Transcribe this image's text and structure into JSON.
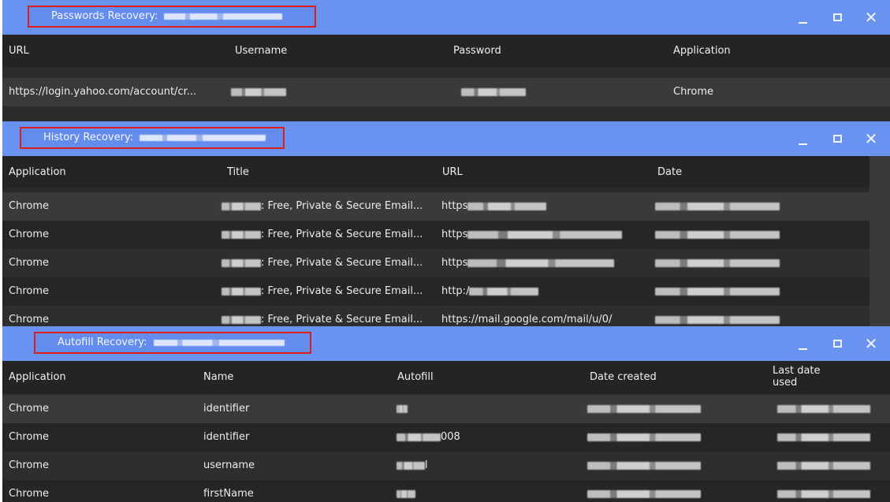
{
  "passwords": {
    "title": "Passwords Recovery:",
    "columns": [
      "URL",
      "Username",
      "Password",
      "Application"
    ],
    "rows": [
      {
        "url": "https://login.yahoo.com/account/cr...",
        "username": "",
        "password": "",
        "application": "Chrome"
      }
    ]
  },
  "history": {
    "title": "History Recovery:",
    "columns": [
      "Application",
      "Title",
      "URL",
      "Date"
    ],
    "rows": [
      {
        "application": "Chrome",
        "title": ": Free, Private & Secure Email...",
        "url": "https"
      },
      {
        "application": "Chrome",
        "title": ": Free, Private & Secure Email...",
        "url": "https"
      },
      {
        "application": "Chrome",
        "title": ": Free, Private & Secure Email...",
        "url": "https"
      },
      {
        "application": "Chrome",
        "title": ": Free, Private & Secure Email...",
        "url": "http:/"
      },
      {
        "application": "Chrome",
        "title": ": Free, Private & Secure Email...",
        "url": "https://mail.google.com/mail/u/0/"
      }
    ]
  },
  "autofill": {
    "title": "Autofill Recovery:",
    "columns": [
      "Application",
      "Name",
      "Autofill",
      "Date created",
      "Last date used"
    ],
    "rows": [
      {
        "application": "Chrome",
        "name": "identifier",
        "autofill": ""
      },
      {
        "application": "Chrome",
        "name": "identifier",
        "autofill": "008"
      },
      {
        "application": "Chrome",
        "name": "username",
        "autofill": "l"
      },
      {
        "application": "Chrome",
        "name": "firstName",
        "autofill": ""
      }
    ]
  },
  "window_controls": {
    "minimize": "",
    "maximize": "",
    "close": "✕"
  },
  "colors": {
    "titlebar": "#6a92f0",
    "highlight_border": "#dd1c1c",
    "table_bg": "#2b2b2b",
    "header_bg": "#242424"
  }
}
